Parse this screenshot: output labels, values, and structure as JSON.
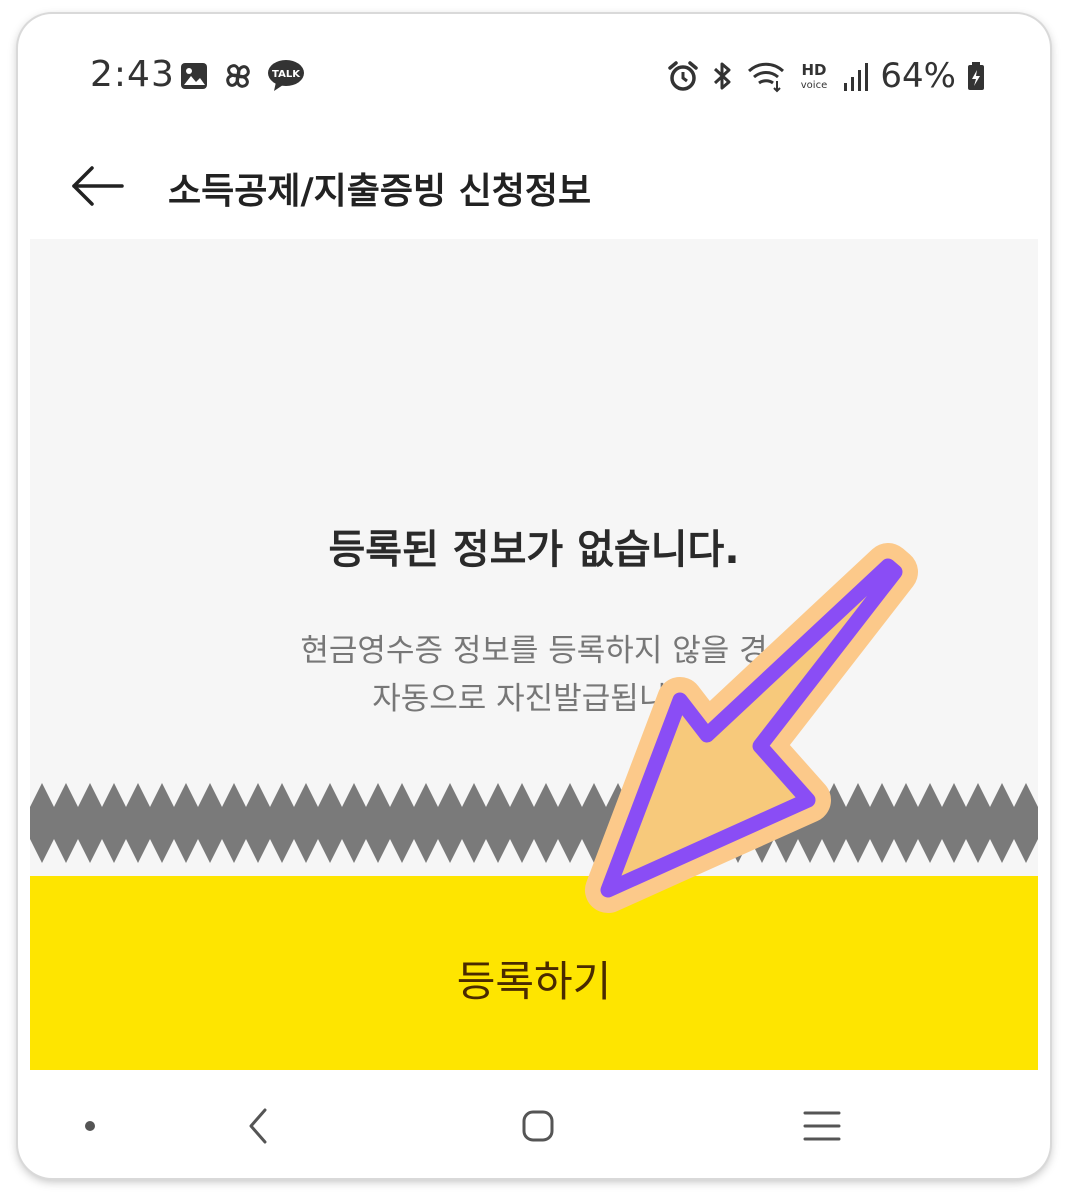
{
  "status_bar": {
    "time": "2:43",
    "battery": "64%",
    "talk_badge": "TALK",
    "hd_label": "HD",
    "voice_label": "voice"
  },
  "header": {
    "title": "소득공제/지출증빙 신청정보"
  },
  "empty_state": {
    "title": "등록된 정보가 없습니다.",
    "description_line1": "현금영수증 정보를 등록하지 않을 경",
    "description_line2": "자동으로 자진발급됩니다"
  },
  "register_button": {
    "label": "등록하기"
  },
  "colors": {
    "accent_yellow": "#fee500",
    "button_text": "#4a2a00",
    "arrow_stroke": "#8a4df5",
    "arrow_fill": "#f7c97b",
    "tear_band": "#7a7a7a"
  }
}
